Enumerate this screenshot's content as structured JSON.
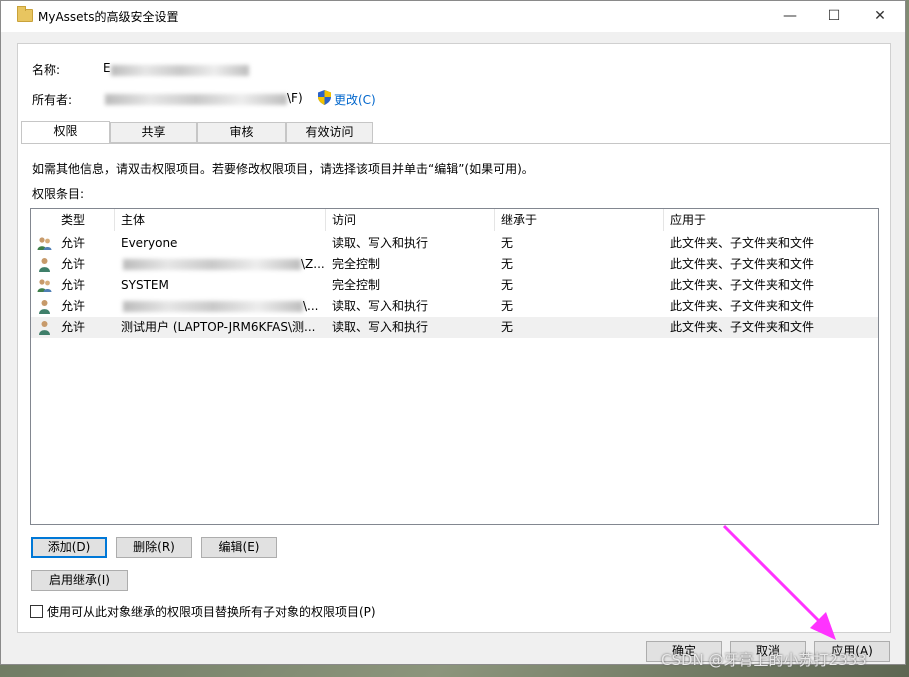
{
  "window": {
    "title": "MyAssets的高级安全设置",
    "minimize_glyph": "—",
    "maximize_glyph": "☐",
    "close_glyph": "✕"
  },
  "name_label": "名称:",
  "name_value_prefix": "E",
  "owner_label": "所有者:",
  "owner_value_suffix": "\\F)",
  "change_link": "更改(C)",
  "tabs": [
    {
      "label": "权限"
    },
    {
      "label": "共享"
    },
    {
      "label": "审核"
    },
    {
      "label": "有效访问"
    }
  ],
  "info_text": "如需其他信息，请双击权限项目。若要修改权限项目，请选择该项目并单击“编辑”(如果可用)。",
  "entries_label": "权限条目:",
  "columns": [
    "类型",
    "主体",
    "访问",
    "继承于",
    "应用于"
  ],
  "rows": [
    {
      "type": "允许",
      "principal": "Everyone",
      "access": "读取、写入和执行",
      "inherited": "无",
      "applies": "此文件夹、子文件夹和文件",
      "icon": "group-icon"
    },
    {
      "type": "允许",
      "principal": "\\Z...",
      "access": "完全控制",
      "inherited": "无",
      "applies": "此文件夹、子文件夹和文件",
      "icon": "user-icon"
    },
    {
      "type": "允许",
      "principal": "SYSTEM",
      "access": "完全控制",
      "inherited": "无",
      "applies": "此文件夹、子文件夹和文件",
      "icon": "group-icon"
    },
    {
      "type": "允许",
      "principal": "\\...",
      "access": "读取、写入和执行",
      "inherited": "无",
      "applies": "此文件夹、子文件夹和文件",
      "icon": "user-icon"
    },
    {
      "type": "允许",
      "principal": "测试用户 (LAPTOP-JRM6KFAS\\测...",
      "access": "读取、写入和执行",
      "inherited": "无",
      "applies": "此文件夹、子文件夹和文件",
      "icon": "user-icon"
    }
  ],
  "buttons": {
    "add": "添加(D)",
    "remove": "删除(R)",
    "edit": "编辑(E)",
    "enable_inheritance": "启用继承(I)",
    "ok": "确定",
    "cancel": "取消",
    "apply": "应用(A)"
  },
  "replace_checkbox_label": "使用可从此对象继承的权限项目替换所有子对象的权限项目(P)",
  "replace_checkbox_checked": false,
  "watermark": "CSDN @牙膏上的小苏打2333",
  "colors": {
    "link": "#0066cc",
    "arrow": "#ff33ff",
    "focus": "#0078d7"
  }
}
